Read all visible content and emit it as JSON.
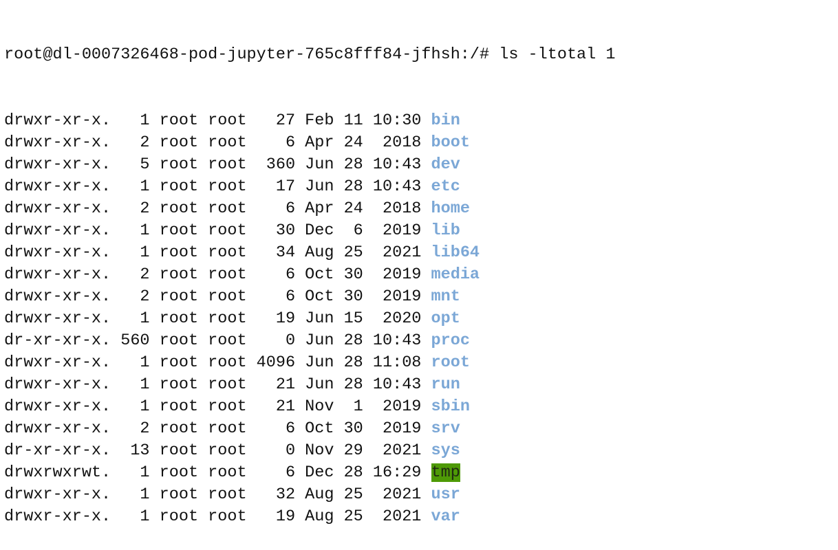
{
  "prompt": "root@dl-0007326468-pod-jupyter-765c8fff84-jfhsh:/# ",
  "command": "ls -l",
  "total": "total 1",
  "colors": {
    "dir": "#7ba7d6",
    "sticky_bg": "#4e9a06"
  },
  "entries": [
    {
      "perm": "drwxr-xr-x.",
      "links": "1",
      "owner": "root",
      "group": "root",
      "size": "27",
      "month": "Feb",
      "day": "11",
      "time": "10:30",
      "name": "bin"
    },
    {
      "perm": "drwxr-xr-x.",
      "links": "2",
      "owner": "root",
      "group": "root",
      "size": "6",
      "month": "Apr",
      "day": "24",
      "time": "2018",
      "name": "boot"
    },
    {
      "perm": "drwxr-xr-x.",
      "links": "5",
      "owner": "root",
      "group": "root",
      "size": "360",
      "month": "Jun",
      "day": "28",
      "time": "10:43",
      "name": "dev"
    },
    {
      "perm": "drwxr-xr-x.",
      "links": "1",
      "owner": "root",
      "group": "root",
      "size": "17",
      "month": "Jun",
      "day": "28",
      "time": "10:43",
      "name": "etc"
    },
    {
      "perm": "drwxr-xr-x.",
      "links": "2",
      "owner": "root",
      "group": "root",
      "size": "6",
      "month": "Apr",
      "day": "24",
      "time": "2018",
      "name": "home"
    },
    {
      "perm": "drwxr-xr-x.",
      "links": "1",
      "owner": "root",
      "group": "root",
      "size": "30",
      "month": "Dec",
      "day": "6",
      "time": "2019",
      "name": "lib"
    },
    {
      "perm": "drwxr-xr-x.",
      "links": "1",
      "owner": "root",
      "group": "root",
      "size": "34",
      "month": "Aug",
      "day": "25",
      "time": "2021",
      "name": "lib64"
    },
    {
      "perm": "drwxr-xr-x.",
      "links": "2",
      "owner": "root",
      "group": "root",
      "size": "6",
      "month": "Oct",
      "day": "30",
      "time": "2019",
      "name": "media"
    },
    {
      "perm": "drwxr-xr-x.",
      "links": "2",
      "owner": "root",
      "group": "root",
      "size": "6",
      "month": "Oct",
      "day": "30",
      "time": "2019",
      "name": "mnt"
    },
    {
      "perm": "drwxr-xr-x.",
      "links": "1",
      "owner": "root",
      "group": "root",
      "size": "19",
      "month": "Jun",
      "day": "15",
      "time": "2020",
      "name": "opt"
    },
    {
      "perm": "dr-xr-xr-x.",
      "links": "560",
      "owner": "root",
      "group": "root",
      "size": "0",
      "month": "Jun",
      "day": "28",
      "time": "10:43",
      "name": "proc"
    },
    {
      "perm": "drwxr-xr-x.",
      "links": "1",
      "owner": "root",
      "group": "root",
      "size": "4096",
      "month": "Jun",
      "day": "28",
      "time": "11:08",
      "name": "root"
    },
    {
      "perm": "drwxr-xr-x.",
      "links": "1",
      "owner": "root",
      "group": "root",
      "size": "21",
      "month": "Jun",
      "day": "28",
      "time": "10:43",
      "name": "run"
    },
    {
      "perm": "drwxr-xr-x.",
      "links": "1",
      "owner": "root",
      "group": "root",
      "size": "21",
      "month": "Nov",
      "day": "1",
      "time": "2019",
      "name": "sbin"
    },
    {
      "perm": "drwxr-xr-x.",
      "links": "2",
      "owner": "root",
      "group": "root",
      "size": "6",
      "month": "Oct",
      "day": "30",
      "time": "2019",
      "name": "srv"
    },
    {
      "perm": "dr-xr-xr-x.",
      "links": "13",
      "owner": "root",
      "group": "root",
      "size": "0",
      "month": "Nov",
      "day": "29",
      "time": "2021",
      "name": "sys"
    },
    {
      "perm": "drwxrwxrwt.",
      "links": "1",
      "owner": "root",
      "group": "root",
      "size": "6",
      "month": "Dec",
      "day": "28",
      "time": "16:29",
      "name": "tmp",
      "sticky": true
    },
    {
      "perm": "drwxr-xr-x.",
      "links": "1",
      "owner": "root",
      "group": "root",
      "size": "32",
      "month": "Aug",
      "day": "25",
      "time": "2021",
      "name": "usr"
    },
    {
      "perm": "drwxr-xr-x.",
      "links": "1",
      "owner": "root",
      "group": "root",
      "size": "19",
      "month": "Aug",
      "day": "25",
      "time": "2021",
      "name": "var"
    }
  ]
}
